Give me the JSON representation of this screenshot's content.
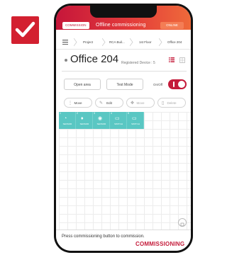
{
  "header": {
    "mode_pill": "COMMISSION",
    "title": "Offline commissioning",
    "status_pill": "ONLINE"
  },
  "breadcrumb": [
    "Project",
    "RCA Buil...",
    "1st Floor",
    "Office 204"
  ],
  "room": {
    "name": "Office 204",
    "registered_label": "Registered Device : 5"
  },
  "actions": {
    "open_area": "Open area",
    "test_mode": "Test Mode",
    "onoff_label": "On/Off"
  },
  "toolbar": {
    "move": "Move",
    "edit": "Edit",
    "move2": "Move",
    "delete": "Delete"
  },
  "devices": [
    {
      "num": "1",
      "label": "SENSOR",
      "icon": "sensor-icon"
    },
    {
      "num": "2",
      "label": "SENSOR",
      "icon": "drop-icon"
    },
    {
      "num": "3",
      "label": "SENSOR",
      "icon": "eye-icon"
    },
    {
      "num": "4",
      "label": "SWITCH",
      "icon": "switch-icon"
    },
    {
      "num": "5",
      "label": "SWITCH",
      "icon": "switch-icon"
    }
  ],
  "footer": {
    "hint": "Press commissioning button to commission.",
    "commission_label": "COMMISSIONING"
  },
  "colors": {
    "brand_red": "#c41b3a",
    "device_teal": "#5ac7c3",
    "header_gradient_end": "#ef6a3a"
  }
}
